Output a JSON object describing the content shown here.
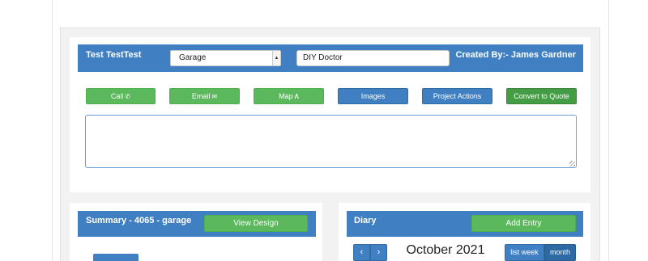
{
  "project": {
    "customer_name": "Test TestTest",
    "room_select_value": "Garage",
    "source_value": "DIY Doctor",
    "created_by": "Created By:- James Gardner",
    "notes_value": ""
  },
  "actions": {
    "call": "Call",
    "email": "Email",
    "map": "Map",
    "images": "Images",
    "project_actions": "Project Actions",
    "convert_to_quote": "Convert to Quote"
  },
  "icons": {
    "call": "phone-icon",
    "email": "envelope-icon",
    "map": "road-icon",
    "select": "dropdown-arrow-icon",
    "prev": "chevron-left-icon",
    "next": "chevron-right-icon"
  },
  "summary": {
    "title": "Summary - 4065 - garage",
    "view_design": "View Design"
  },
  "diary": {
    "title": "Diary",
    "add_entry": "Add Entry",
    "calendar_title": "October 2021",
    "view_list_week": "list week",
    "view_month": "month",
    "active_view": "month"
  },
  "colors": {
    "header_blue": "#3f7fc2",
    "button_green": "#5cb85c",
    "button_dark_green": "#449d44",
    "input_focus_border": "#6b9edb"
  }
}
